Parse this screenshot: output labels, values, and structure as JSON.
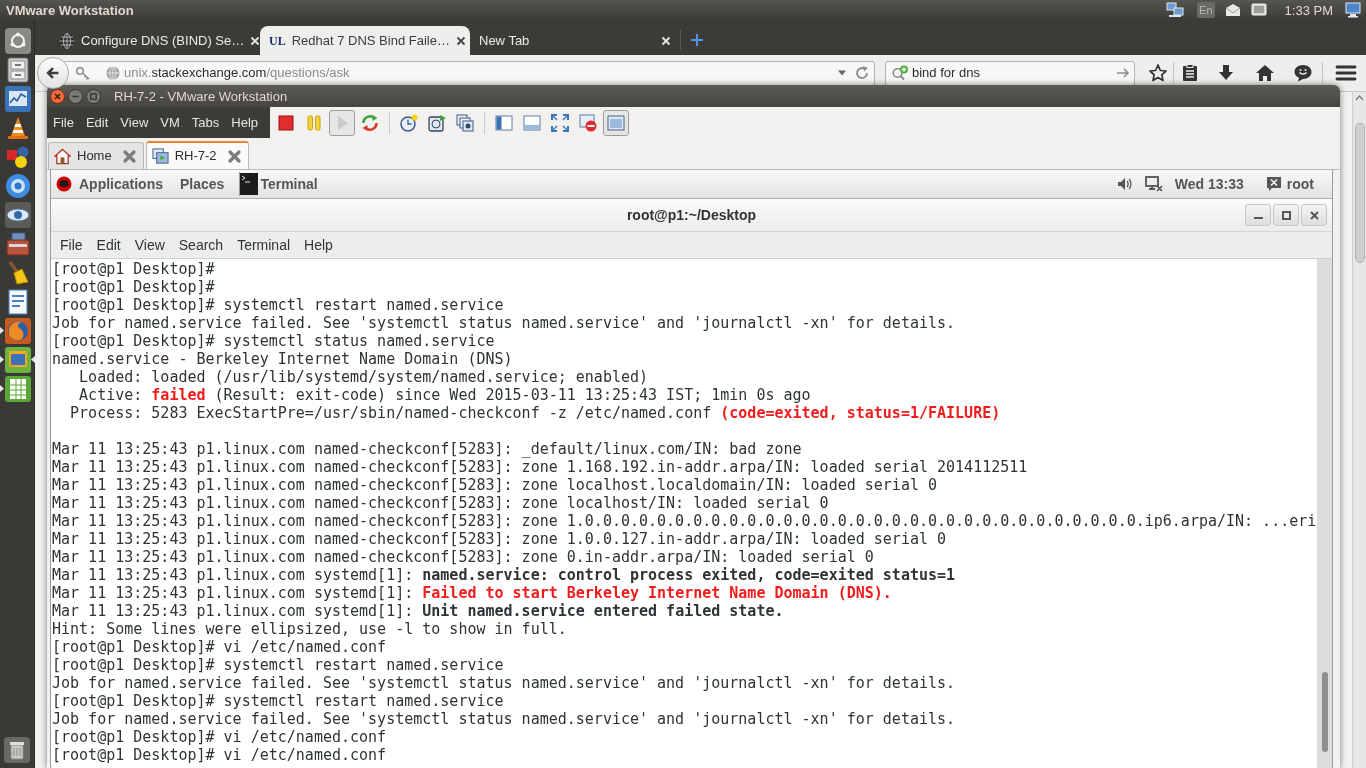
{
  "top_panel": {
    "title": "VMware Workstation",
    "keyboard_layout": "En",
    "clock": "1:33 PM"
  },
  "launcher": {
    "items": [
      {
        "kind": "dash",
        "running": false,
        "focused": false
      },
      {
        "kind": "cabinet",
        "running": false,
        "focused": false
      },
      {
        "kind": "chart",
        "running": false,
        "focused": false
      },
      {
        "kind": "cone",
        "running": false,
        "focused": false
      },
      {
        "kind": "shapes",
        "running": false,
        "focused": false
      },
      {
        "kind": "sphere",
        "running": false,
        "focused": false
      },
      {
        "kind": "eye",
        "running": false,
        "focused": false
      },
      {
        "kind": "toolbox",
        "running": false,
        "focused": false
      },
      {
        "kind": "broom",
        "running": false,
        "focused": false
      },
      {
        "kind": "document",
        "running": false,
        "focused": false
      },
      {
        "kind": "browser",
        "running": true,
        "focused": false
      },
      {
        "kind": "vm",
        "running": true,
        "focused": true
      },
      {
        "kind": "spreadsheet",
        "running": true,
        "focused": false
      }
    ]
  },
  "browser": {
    "tabs": [
      {
        "title": "Configure DNS (BIND) Se…",
        "selected": false,
        "favicon": {
          "kind": "globe"
        }
      },
      {
        "title": "Redhat 7 DNS Bind Faile…",
        "selected": true,
        "favicon": {
          "kind": "letters",
          "text": "UL"
        }
      },
      {
        "title": "New Tab",
        "selected": false
      }
    ],
    "address": {
      "subdomain": "unix.",
      "domain": "stackexchange.com",
      "path": "/questions/ask"
    },
    "search": {
      "value": "bind for dns"
    }
  },
  "vmware": {
    "title": "RH-7-2 - VMware Workstation",
    "menu": [
      "File",
      "Edit",
      "View",
      "VM",
      "Tabs",
      "Help"
    ],
    "toolbar_groups": [
      {
        "buttons": [
          {
            "kind": "stop",
            "pressed": false
          },
          {
            "kind": "pause",
            "pressed": false
          },
          {
            "kind": "play",
            "pressed": true
          },
          {
            "kind": "reset",
            "pressed": false
          }
        ]
      },
      {
        "buttons": [
          {
            "kind": "snapshot",
            "pressed": false
          },
          {
            "kind": "revert",
            "pressed": false
          },
          {
            "kind": "snapshot_manager",
            "pressed": false
          }
        ]
      },
      {
        "buttons": [
          {
            "kind": "library",
            "pressed": false
          },
          {
            "kind": "thumbnails",
            "pressed": false
          },
          {
            "kind": "fullscreen",
            "pressed": false
          },
          {
            "kind": "unity",
            "pressed": false
          },
          {
            "kind": "console",
            "pressed": true
          }
        ]
      }
    ],
    "tabs": [
      {
        "label": "Home",
        "kind": "home",
        "selected": false
      },
      {
        "label": "RH-7-2",
        "kind": "vm",
        "selected": true
      }
    ]
  },
  "guest_panel": {
    "menus": [
      "Applications",
      "Places"
    ],
    "window_list": [
      {
        "label": "Terminal"
      }
    ],
    "clock": "Wed 13:33",
    "user": "root"
  },
  "terminal": {
    "title": "root@p1:~/Desktop",
    "menu": [
      "File",
      "Edit",
      "View",
      "Search",
      "Terminal",
      "Help"
    ],
    "lines": [
      {
        "kind": "text",
        "segments": [
          {
            "text": "[root@p1 Desktop]#",
            "kind": "plain"
          }
        ]
      },
      {
        "kind": "text",
        "segments": [
          {
            "text": "[root@p1 Desktop]#",
            "kind": "plain"
          }
        ]
      },
      {
        "kind": "text",
        "segments": [
          {
            "text": "[root@p1 Desktop]# systemctl restart named.service",
            "kind": "plain"
          }
        ]
      },
      {
        "kind": "text",
        "segments": [
          {
            "text": "Job for named.service failed. See 'systemctl status named.service' and 'journalctl -xn' for details.",
            "kind": "plain"
          }
        ]
      },
      {
        "kind": "text",
        "segments": [
          {
            "text": "[root@p1 Desktop]# systemctl status named.service",
            "kind": "plain"
          }
        ]
      },
      {
        "kind": "text",
        "segments": [
          {
            "text": "named.service - Berkeley Internet Name Domain (DNS)",
            "kind": "plain"
          }
        ]
      },
      {
        "kind": "text",
        "segments": [
          {
            "text": "   Loaded: loaded (/usr/lib/systemd/system/named.service; enabled)",
            "kind": "plain"
          }
        ]
      },
      {
        "kind": "text",
        "segments": [
          {
            "text": "   Active: ",
            "kind": "plain"
          },
          {
            "text": "failed",
            "kind": "error"
          },
          {
            "text": " (Result: exit-code) since Wed 2015-03-11 13:25:43 IST; 1min 0s ago",
            "kind": "plain"
          }
        ]
      },
      {
        "kind": "text",
        "segments": [
          {
            "text": "  Process: 5283 ExecStartPre=/usr/sbin/named-checkconf -z /etc/named.conf ",
            "kind": "plain"
          },
          {
            "text": "(code=exited, status=1/FAILURE)",
            "kind": "error"
          }
        ]
      },
      {
        "kind": "blank"
      },
      {
        "kind": "text",
        "segments": [
          {
            "text": "Mar 11 13:25:43 p1.linux.com named-checkconf[5283]: _default/linux.com/IN: bad zone",
            "kind": "plain"
          }
        ]
      },
      {
        "kind": "text",
        "segments": [
          {
            "text": "Mar 11 13:25:43 p1.linux.com named-checkconf[5283]: zone 1.168.192.in-addr.arpa/IN: loaded serial 2014112511",
            "kind": "plain"
          }
        ]
      },
      {
        "kind": "text",
        "segments": [
          {
            "text": "Mar 11 13:25:43 p1.linux.com named-checkconf[5283]: zone localhost.localdomain/IN: loaded serial 0",
            "kind": "plain"
          }
        ]
      },
      {
        "kind": "text",
        "segments": [
          {
            "text": "Mar 11 13:25:43 p1.linux.com named-checkconf[5283]: zone localhost/IN: loaded serial 0",
            "kind": "plain"
          }
        ]
      },
      {
        "kind": "text",
        "segments": [
          {
            "text": "Mar 11 13:25:43 p1.linux.com named-checkconf[5283]: zone 1.0.0.0.0.0.0.0.0.0.0.0.0.0.0.0.0.0.0.0.0.0.0.0.0.0.0.0.0.0.0.0.ip6.arpa/IN: ...eri",
            "kind": "plain"
          }
        ]
      },
      {
        "kind": "text",
        "segments": [
          {
            "text": "Mar 11 13:25:43 p1.linux.com named-checkconf[5283]: zone 1.0.0.127.in-addr.arpa/IN: loaded serial 0",
            "kind": "plain"
          }
        ]
      },
      {
        "kind": "text",
        "segments": [
          {
            "text": "Mar 11 13:25:43 p1.linux.com named-checkconf[5283]: zone 0.in-addr.arpa/IN: loaded serial 0",
            "kind": "plain"
          }
        ]
      },
      {
        "kind": "text",
        "segments": [
          {
            "text": "Mar 11 13:25:43 p1.linux.com systemd[1]: ",
            "kind": "plain"
          },
          {
            "text": "named.service: control process exited, code=exited status=1",
            "kind": "bold"
          }
        ]
      },
      {
        "kind": "text",
        "segments": [
          {
            "text": "Mar 11 13:25:43 p1.linux.com systemd[1]: ",
            "kind": "plain"
          },
          {
            "text": "Failed to start Berkeley Internet Name Domain (DNS).",
            "kind": "error"
          }
        ]
      },
      {
        "kind": "text",
        "segments": [
          {
            "text": "Mar 11 13:25:43 p1.linux.com systemd[1]: ",
            "kind": "plain"
          },
          {
            "text": "Unit named.service entered failed state.",
            "kind": "bold"
          }
        ]
      },
      {
        "kind": "text",
        "segments": [
          {
            "text": "Hint: Some lines were ellipsized, use -l to show in full.",
            "kind": "plain"
          }
        ]
      },
      {
        "kind": "text",
        "segments": [
          {
            "text": "[root@p1 Desktop]# vi /etc/named.conf",
            "kind": "plain"
          }
        ]
      },
      {
        "kind": "text",
        "segments": [
          {
            "text": "[root@p1 Desktop]# systemctl restart named.service",
            "kind": "plain"
          }
        ]
      },
      {
        "kind": "text",
        "segments": [
          {
            "text": "Job for named.service failed. See 'systemctl status named.service' and 'journalctl -xn' for details.",
            "kind": "plain"
          }
        ]
      },
      {
        "kind": "text",
        "segments": [
          {
            "text": "[root@p1 Desktop]# systemctl restart named.service",
            "kind": "plain"
          }
        ]
      },
      {
        "kind": "text",
        "segments": [
          {
            "text": "Job for named.service failed. See 'systemctl status named.service' and 'journalctl -xn' for details.",
            "kind": "plain"
          }
        ]
      },
      {
        "kind": "text",
        "segments": [
          {
            "text": "[root@p1 Desktop]# vi /etc/named.conf",
            "kind": "plain"
          }
        ]
      },
      {
        "kind": "text",
        "segments": [
          {
            "text": "[root@p1 Desktop]# vi /etc/named.conf",
            "kind": "plain"
          }
        ]
      }
    ]
  }
}
